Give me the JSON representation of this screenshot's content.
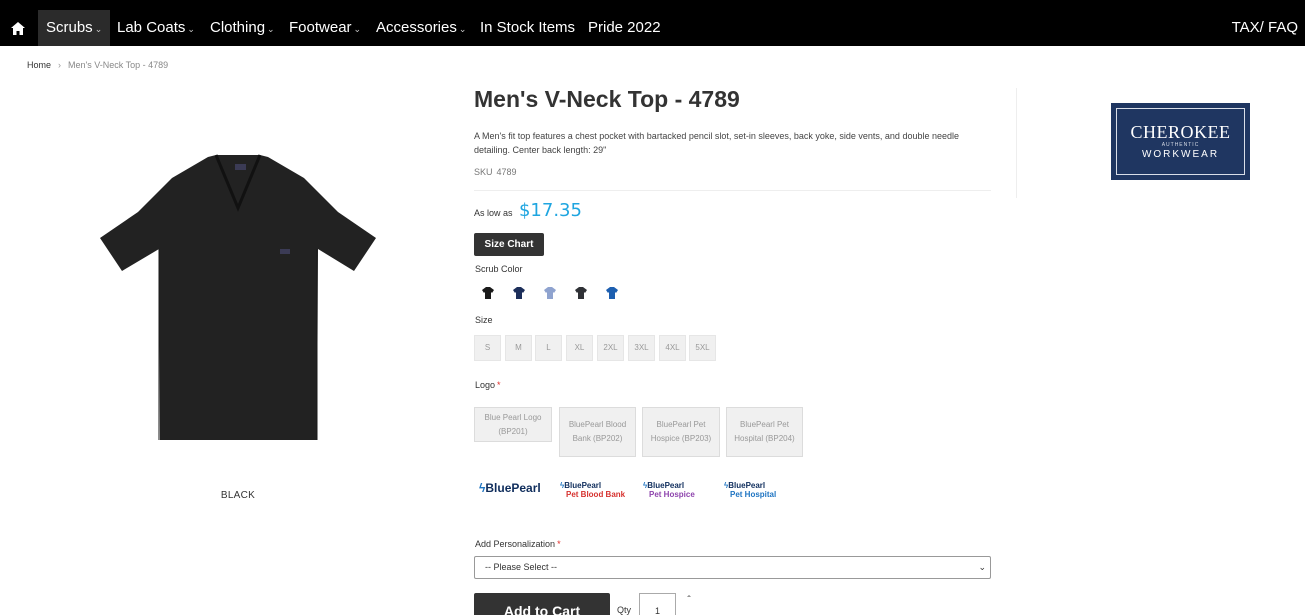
{
  "nav": {
    "items": [
      {
        "label": "Scrubs",
        "caret": "⌄"
      },
      {
        "label": "Lab Coats",
        "caret": "⌄"
      },
      {
        "label": "Clothing",
        "caret": "⌄"
      },
      {
        "label": "Footwear",
        "caret": "⌄"
      },
      {
        "label": "Accessories",
        "caret": "⌄"
      },
      {
        "label": "In Stock Items"
      },
      {
        "label": "Pride 2022"
      }
    ],
    "right_link": "TAX/ FAQ",
    "home_icon": "home-icon"
  },
  "breadcrumb": {
    "home": "Home",
    "separator": "›",
    "current": "Men's V-Neck Top - 4789"
  },
  "product": {
    "title": "Men's V-Neck Top - 4789",
    "description": "A Men's fit top features a chest pocket with bartacked pencil slot, set-in sleeves, back yoke, side vents, and double needle detailing. Center back length: 29\"",
    "sku_label": "SKU",
    "sku": "4789",
    "price_label": "As low as",
    "price": "$17.35",
    "size_chart_label": "Size Chart",
    "image_color_caption": "BLACK",
    "image_color": "#222222"
  },
  "options": {
    "scrub_color_label": "Scrub Color",
    "swatch_colors": [
      "#1a1a1a",
      "#1c2e5a",
      "#8fa3cf",
      "#2f3136",
      "#1d5fb0"
    ],
    "size_label": "Size",
    "sizes": [
      "S",
      "M",
      "L",
      "XL",
      "2XL",
      "3XL",
      "4XL",
      "5XL"
    ],
    "logo_label": "Logo",
    "required_mark": "*",
    "logos": [
      "Blue Pearl Logo (BP201)",
      "BluePearl Blood Bank (BP202)",
      "BluePearl Pet Hospice (BP203)",
      "BluePearl Pet Hospital (BP204)"
    ],
    "brand_logo_texts": [
      {
        "top": "BluePearl",
        "bottom": ""
      },
      {
        "top": "BluePearl",
        "bottom": "Pet Blood Bank",
        "color": "#d6322f"
      },
      {
        "top": "BluePearl",
        "bottom": "Pet Hospice",
        "color": "#8e44ad"
      },
      {
        "top": "BluePearl",
        "bottom": "Pet Hospital",
        "color": "#1e74c2"
      }
    ],
    "personalization_label": "Add Personalization",
    "personalization_selected": "-- Please Select --"
  },
  "cart": {
    "add_to_cart_label": "Add to Cart",
    "qty_label": "Qty",
    "qty_value": "1"
  },
  "brand": {
    "name": "CHEROKEE",
    "mid": "AUTHENTIC",
    "sub": "WORKWEAR",
    "color": "#1f3661"
  }
}
